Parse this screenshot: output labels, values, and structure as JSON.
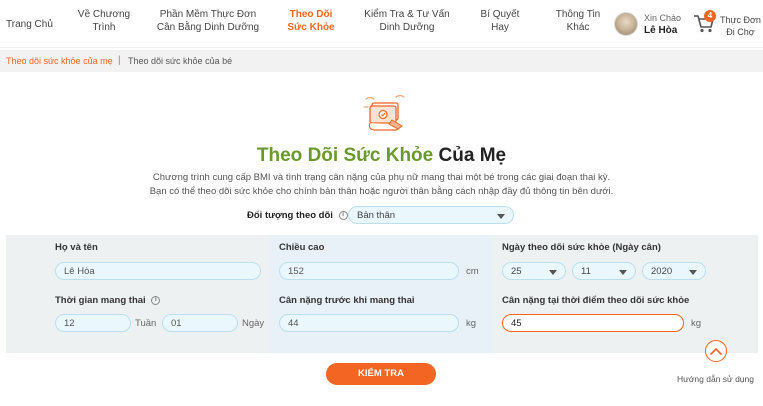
{
  "nav": {
    "home": "Trang Chủ",
    "items": [
      {
        "label": "Về Chương\nTrình"
      },
      {
        "label": "Phần Mềm Thực Đơn\nCân Bằng Dinh Dưỡng"
      },
      {
        "label": "Theo Dõi\nSức Khỏe"
      },
      {
        "label": "Kiểm Tra & Tư Vấn\nDinh Dưỡng"
      },
      {
        "label": "Bí Quyết\nHay"
      },
      {
        "label": "Thông Tin\nKhác"
      }
    ],
    "greeting": "Xin Chào",
    "user_name": "Lê Hòa",
    "cart_count": "4",
    "cart_label": "Thực Đơn\nĐi Chợ"
  },
  "subtabs": {
    "mother": "Theo dõi sức khỏe của mẹ",
    "separator": "|",
    "baby": "Theo dõi sức khỏe của bé"
  },
  "hero": {
    "title_green": "Theo Dõi Sức Khỏe",
    "title_dark": "Của Mẹ",
    "desc_line1": "Chương trình cung cấp BMI và tình trạng cân nặng của phụ nữ mang thai một bé trong các giai đoạn thai kỳ.",
    "desc_line2": "Bạn có thể theo dõi sức khỏe cho chính bản thân hoặc người thân bằng cách nhập đầy đủ thông tin bên dưới."
  },
  "target": {
    "label": "Đối tượng theo dõi",
    "value": "Bản thân"
  },
  "form": {
    "name_label": "Họ và tên",
    "name_value": "Lê Hòa",
    "height_label": "Chiều cao",
    "height_value": "152",
    "height_unit": "cm",
    "date_label": "Ngày theo dõi sức khỏe (Ngày cân)",
    "day": "25",
    "month": "11",
    "year": "2020",
    "pregnancy_label": "Thời gian mang thai",
    "weeks_value": "12",
    "weeks_unit": "Tuần",
    "days_value": "01",
    "days_unit": "Ngày",
    "pre_weight_label": "Cân nặng trước khi mang thai",
    "pre_weight_value": "44",
    "pre_weight_unit": "kg",
    "cur_weight_label": "Cân nặng tại thời điểm theo dõi sức khỏe",
    "cur_weight_value": "45",
    "cur_weight_unit": "kg"
  },
  "help_label": "Hướng dẫn sử dụng",
  "submit_label": "KIỂM TRA",
  "colors": {
    "accent": "#f26522",
    "green": "#6a9a2e"
  }
}
